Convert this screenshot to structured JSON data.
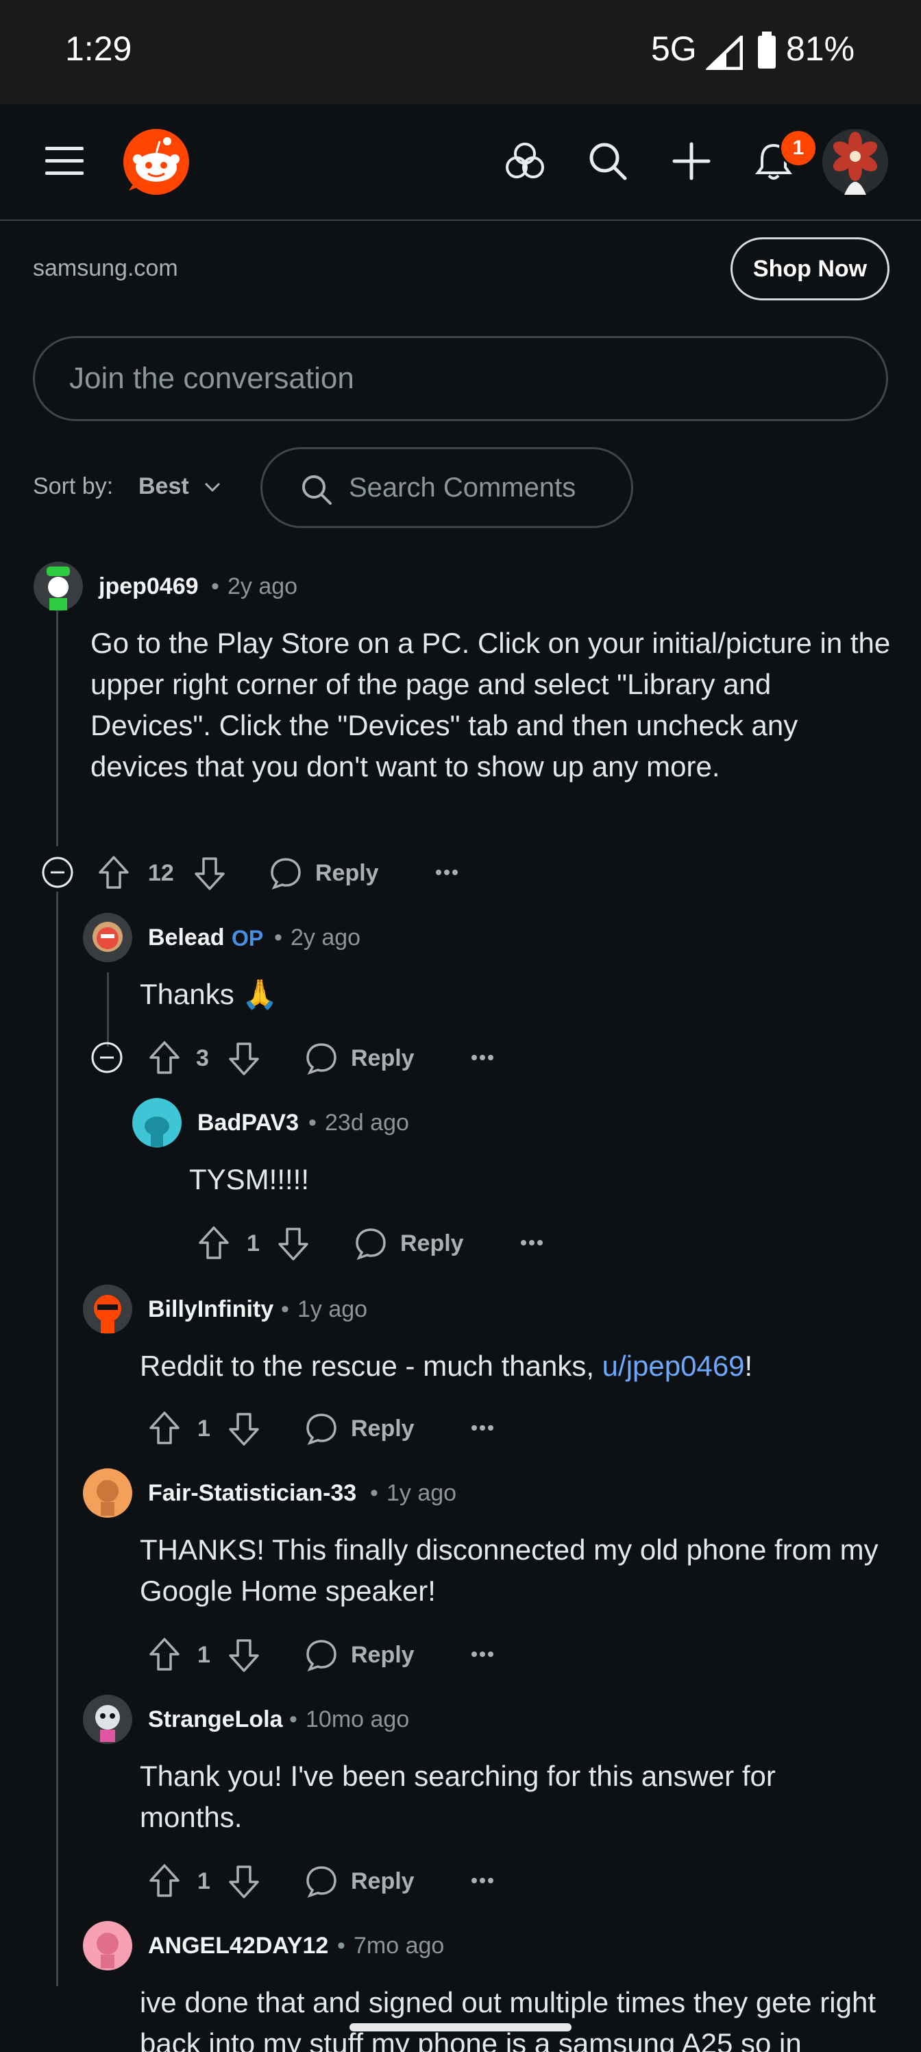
{
  "status": {
    "time": "1:29",
    "network": "5G",
    "battery": "81%"
  },
  "header": {
    "notification_count": "1"
  },
  "ad": {
    "domain": "samsung.com",
    "cta": "Shop Now"
  },
  "composer": {
    "placeholder": "Join the conversation"
  },
  "sort": {
    "label": "Sort by:",
    "value": "Best"
  },
  "search": {
    "placeholder": "Search Comments"
  },
  "reply_label": "Reply",
  "comments": [
    {
      "user": "jpep0469",
      "sep": "•",
      "age": "2y ago",
      "body": "Go to the Play Store on a PC. Click on your initial/picture in the upper right corner of the page and select \"Library and Devices\". Click the \"Devices\" tab and then uncheck any devices that you don't want to show up any more.",
      "votes": "12"
    },
    {
      "user": "Belead",
      "op": "OP",
      "sep": "•",
      "age": "2y ago",
      "body": "Thanks 🙏",
      "votes": "3"
    },
    {
      "user": "BadPAV3",
      "sep": "•",
      "age": "23d ago",
      "body": "TYSM!!!!!",
      "votes": "1"
    },
    {
      "user": "BillyInfinity",
      "sep": "•",
      "age": "1y ago",
      "body_pre": "Reddit to the rescue - much thanks, ",
      "body_link": "u/jpep0469",
      "body_post": "!",
      "votes": "1"
    },
    {
      "user": "Fair-Statistician-33",
      "sep": "•",
      "age": "1y ago",
      "body": "THANKS! This finally disconnected my old phone from my Google Home speaker!",
      "votes": "1"
    },
    {
      "user": "StrangeLola",
      "sep": "•",
      "age": "10mo ago",
      "body": "Thank you! I've been searching for this answer for months.",
      "votes": "1"
    },
    {
      "user": "ANGEL42DAY12",
      "sep": "•",
      "age": "7mo ago",
      "body": "ive done that and signed out multiple times they gete right back into my stuff my phone is a samsung A25 so in"
    }
  ],
  "colors": {
    "background": "#0e1113",
    "accent": "#ff4500",
    "link": "#6aa9ff",
    "op": "#4a90e2"
  }
}
